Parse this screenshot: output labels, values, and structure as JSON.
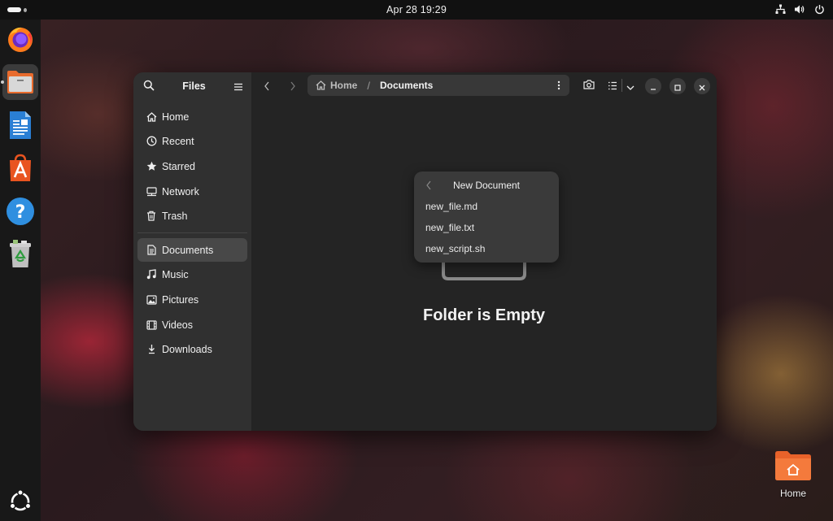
{
  "topbar": {
    "clock": "Apr 28  19:29",
    "icons": [
      "network-icon",
      "volume-icon",
      "power-icon"
    ]
  },
  "dock": {
    "apps": [
      "firefox-icon",
      "files-icon",
      "writer-icon",
      "app-center-icon",
      "help-icon",
      "trash-icon"
    ],
    "show_apps_icon": "ubuntu-logo-icon"
  },
  "window": {
    "sidebar": {
      "title": "Files",
      "places": [
        {
          "label": "Home",
          "icon": "home-icon"
        },
        {
          "label": "Recent",
          "icon": "clock-icon"
        },
        {
          "label": "Starred",
          "icon": "star-icon"
        },
        {
          "label": "Network",
          "icon": "network-icon"
        },
        {
          "label": "Trash",
          "icon": "trash-icon"
        }
      ],
      "bookmarks": [
        {
          "label": "Documents",
          "icon": "document-icon",
          "selected": true
        },
        {
          "label": "Music",
          "icon": "music-icon"
        },
        {
          "label": "Pictures",
          "icon": "picture-icon"
        },
        {
          "label": "Videos",
          "icon": "video-icon"
        },
        {
          "label": "Downloads",
          "icon": "download-icon"
        }
      ]
    },
    "pathbar": {
      "home_label": "Home",
      "separator": "/",
      "current": "Documents"
    },
    "empty_state": {
      "title": "Folder is Empty"
    },
    "popover": {
      "title": "New Document",
      "items": [
        "new_file.md",
        "new_file.txt",
        "new_script.sh"
      ]
    }
  },
  "desktop": {
    "home_icon_label": "Home"
  },
  "colors": {
    "accent": "#e95420",
    "window_bg": "#242424",
    "sidebar_bg": "#303030"
  }
}
